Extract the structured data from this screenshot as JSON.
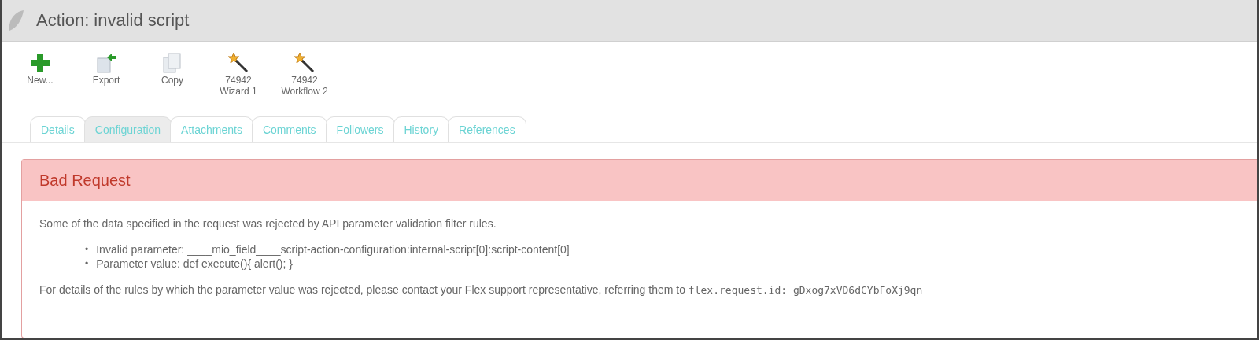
{
  "window": {
    "title": "Action: invalid script"
  },
  "toolbar": [
    {
      "kind": "new",
      "lines": [
        "New..."
      ]
    },
    {
      "kind": "export",
      "lines": [
        "Export"
      ]
    },
    {
      "kind": "copy",
      "lines": [
        "Copy"
      ]
    },
    {
      "kind": "wand",
      "lines": [
        "74942",
        "Wizard 1"
      ]
    },
    {
      "kind": "wand",
      "lines": [
        "74942",
        "Workflow 2"
      ]
    }
  ],
  "tabs": [
    {
      "label": "Details",
      "selected": false
    },
    {
      "label": "Configuration",
      "selected": true
    },
    {
      "label": "Attachments",
      "selected": false
    },
    {
      "label": "Comments",
      "selected": false
    },
    {
      "label": "Followers",
      "selected": false
    },
    {
      "label": "History",
      "selected": false
    },
    {
      "label": "References",
      "selected": false
    }
  ],
  "error": {
    "title": "Bad Request",
    "intro": "Some of the data specified in the request was rejected by API parameter validation filter rules.",
    "items": [
      {
        "bullet": "•",
        "text": "Invalid parameter: ____mio_field____script-action-configuration:internal-script[0]:script-content[0]"
      },
      {
        "bullet": "•",
        "text": "Parameter value: def execute(){ alert(); }"
      }
    ],
    "footer": {
      "text": "For details of the rules by which the parameter value was rejected, please contact your Flex support representative, referring them to ",
      "code": "flex.request.id: gDxog7xVD6dCYbFoXj9qn"
    }
  }
}
